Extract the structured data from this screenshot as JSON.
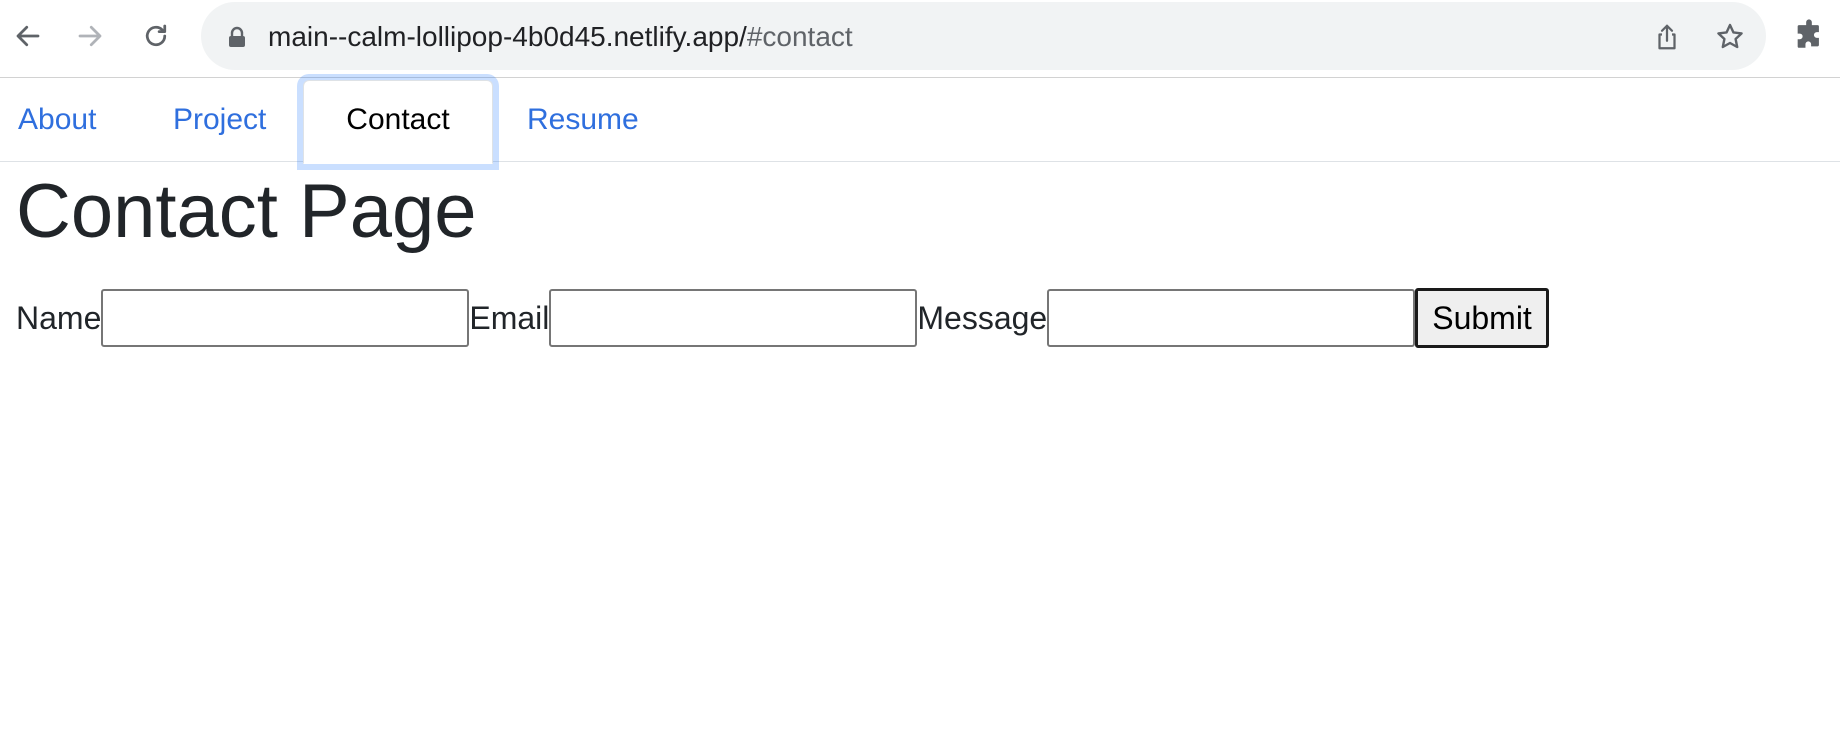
{
  "browser": {
    "url_host": "main--calm-lollipop-4b0d45.netlify.app/",
    "url_path": "#contact",
    "icons": {
      "back": "arrow-left-icon",
      "forward": "arrow-right-icon",
      "reload": "reload-icon",
      "lock": "lock-icon",
      "share": "share-icon",
      "bookmark": "star-icon",
      "extensions": "puzzle-icon"
    }
  },
  "nav": {
    "items": [
      {
        "label": "About",
        "active": false
      },
      {
        "label": "Project",
        "active": false
      },
      {
        "label": "Contact",
        "active": true
      },
      {
        "label": "Resume",
        "active": false
      }
    ],
    "link_color": "#2f6fde",
    "active_color": "#000000"
  },
  "page": {
    "title": "Contact Page"
  },
  "form": {
    "name_label": "Name",
    "name_value": "",
    "email_label": "Email",
    "email_value": "",
    "message_label": "Message",
    "message_value": "",
    "submit_label": "Submit"
  }
}
